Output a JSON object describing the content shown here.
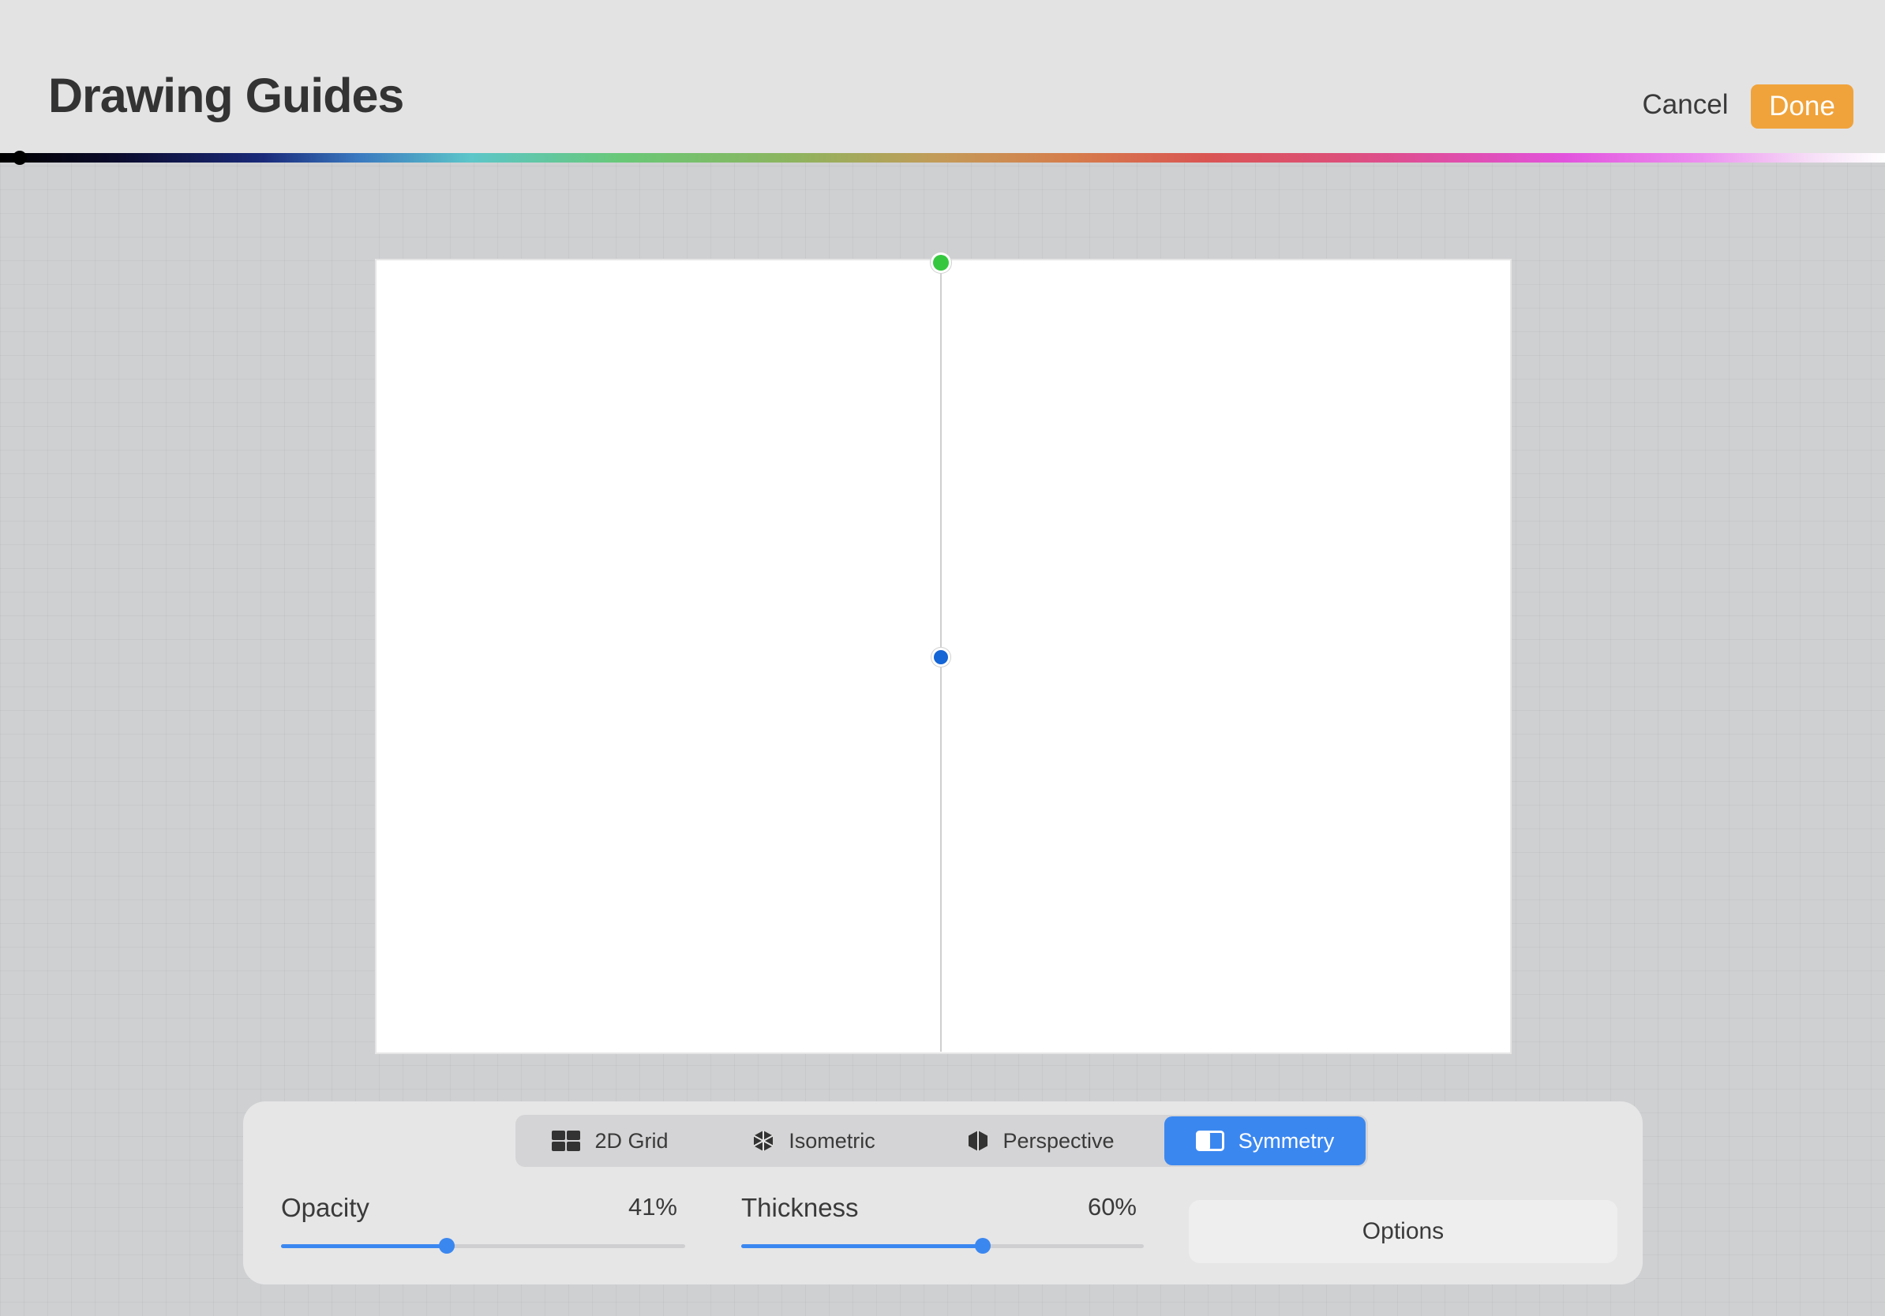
{
  "header": {
    "title": "Drawing Guides",
    "cancel_label": "Cancel",
    "done_label": "Done"
  },
  "spectrum": {
    "selected_color": "#000000"
  },
  "canvas": {
    "guide_type": "symmetry",
    "axis": "vertical"
  },
  "guide_tabs": [
    {
      "label": "2D Grid",
      "icon": "grid-icon",
      "active": false
    },
    {
      "label": "Isometric",
      "icon": "cube-icon",
      "active": false
    },
    {
      "label": "Perspective",
      "icon": "hexagon-icon",
      "active": false
    },
    {
      "label": "Symmetry",
      "icon": "symmetry-icon",
      "active": true
    }
  ],
  "opacity": {
    "label": "Opacity",
    "value_text": "41%",
    "value": 0.41
  },
  "thickness": {
    "label": "Thickness",
    "value_text": "60%",
    "value": 0.6
  },
  "options_label": "Options",
  "colors": {
    "accent": "#3b87f0",
    "done": "#f0a33b",
    "top_node": "#35c83f",
    "center_node": "#1465d6"
  }
}
